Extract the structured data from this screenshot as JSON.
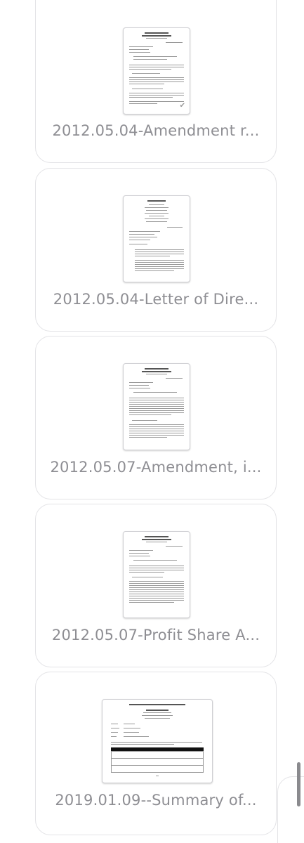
{
  "attachments": [
    {
      "title": "2012.05.04-Amendment r..."
    },
    {
      "title": "2012.05.04-Letter of Dire..."
    },
    {
      "title": "2012.05.07-Amendment, i..."
    },
    {
      "title": "2012.05.07-Profit Share A..."
    },
    {
      "title": "2019.01.09--Summary of..."
    }
  ],
  "colors": {
    "label": "#8e8e93",
    "card_border": "#e3e3e6",
    "scroll_indicator": "#8a8a8e"
  },
  "icons": [
    "document-thumbnail-icon",
    "checkmark-icon"
  ]
}
